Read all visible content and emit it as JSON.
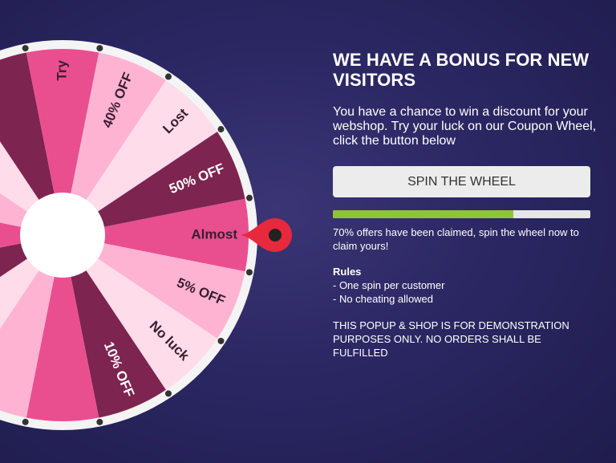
{
  "popup": {
    "title": "WE HAVE A BONUS FOR NEW VISITORS",
    "intro": "You have a chance to win a discount for your webshop. Try your luck on our Coupon Wheel, click the button below",
    "spin_label": "SPIN THE WHEEL",
    "progress": 0.7,
    "progress_color": "#8fc43a",
    "claimed_text": "70% offers have been claimed, spin the wheel now to claim yours!",
    "rules_title": "Rules",
    "rules": [
      "- One spin per customer",
      "- No cheating allowed"
    ],
    "disclaimer": "THIS POPUP & SHOP IS FOR DEMONSTRATION PURPOSES ONLY. NO ORDERS SHALL BE FULFILLED"
  },
  "wheel": {
    "segments": [
      {
        "label": "Almost",
        "color": "#e94f8f"
      },
      {
        "label": "5% OFF",
        "color": "#ffb3d3"
      },
      {
        "label": "No luck",
        "color": "#ffdcea"
      },
      {
        "label": "10% OFF",
        "color": "#7d2451"
      },
      {
        "label": "",
        "color": "#e94f8f"
      },
      {
        "label": "",
        "color": "#ffb3d3"
      },
      {
        "label": "",
        "color": "#ffdcea"
      },
      {
        "label": "",
        "color": "#7d2451"
      },
      {
        "label": "",
        "color": "#e94f8f"
      },
      {
        "label": "",
        "color": "#ffb3d3"
      },
      {
        "label": "",
        "color": "#ffdcea"
      },
      {
        "label": "",
        "color": "#7d2451"
      },
      {
        "label": "Try",
        "color": "#e94f8f"
      },
      {
        "label": "40% OFF",
        "color": "#ffb3d3"
      },
      {
        "label": "Lost",
        "color": "#ffdcea"
      },
      {
        "label": "50% OFF",
        "color": "#7d2451"
      }
    ],
    "rim_color": "#f4f4f4",
    "pointer_color": "#e8283c"
  }
}
